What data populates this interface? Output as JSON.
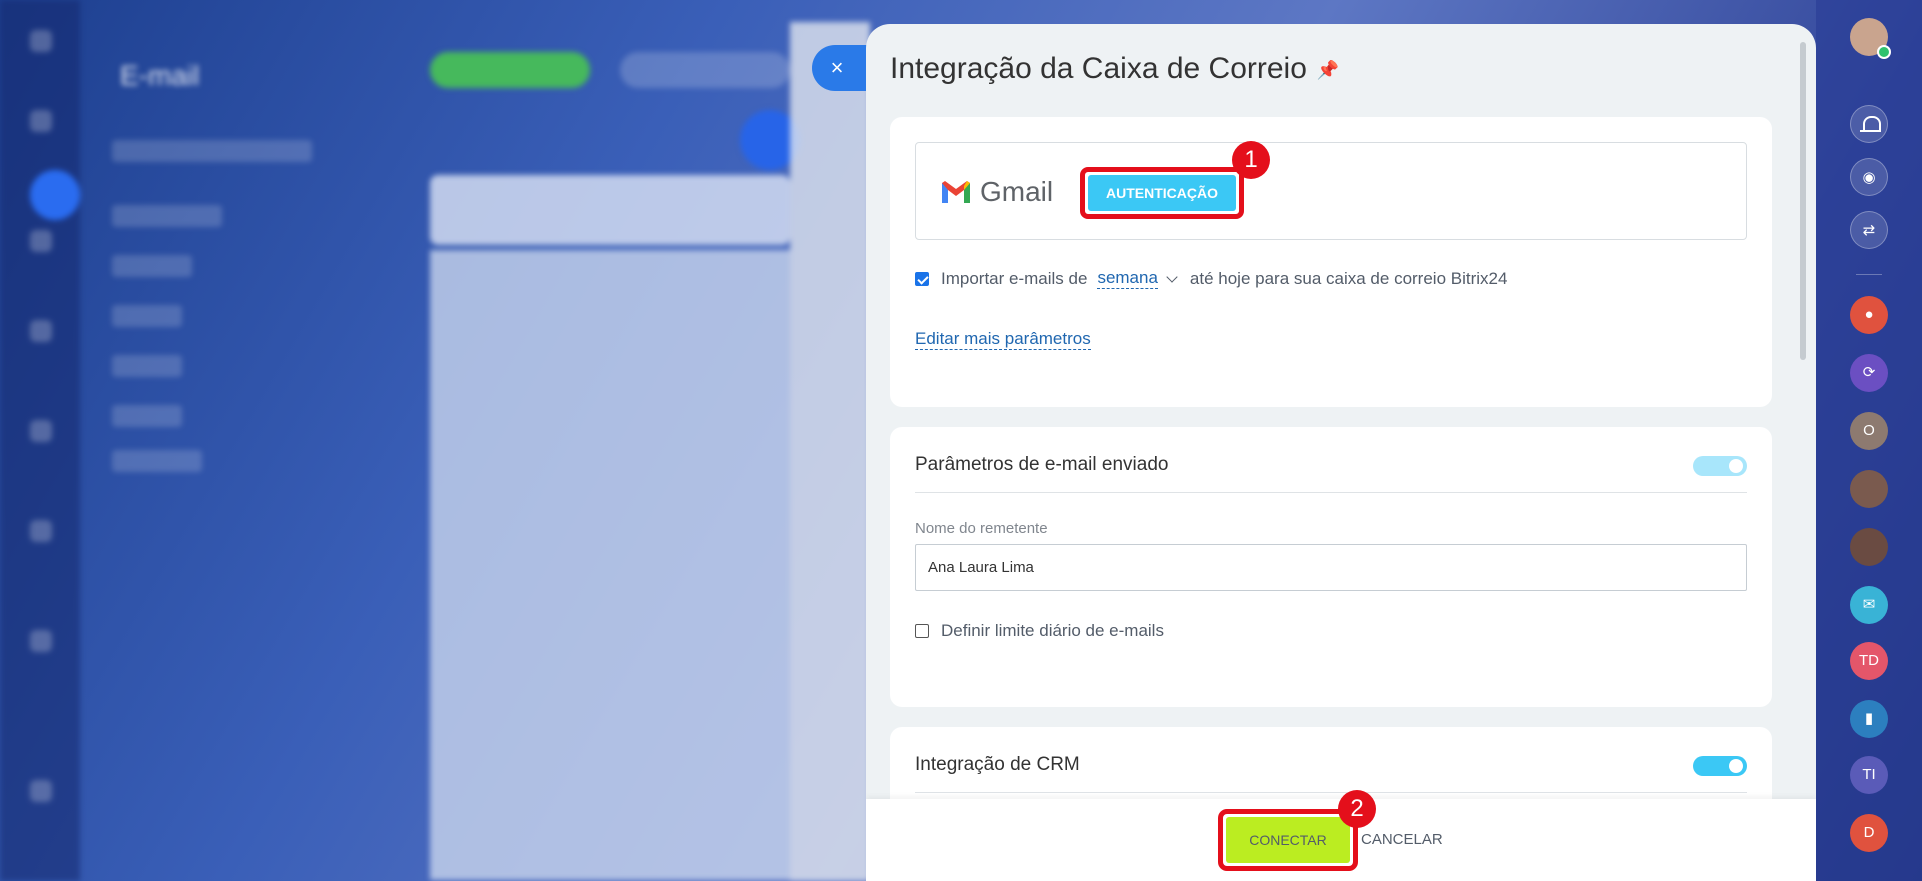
{
  "background": {
    "app_title": "E-mail"
  },
  "panel": {
    "title": "Integração da Caixa de Correio",
    "close_symbol": "×"
  },
  "auth_card": {
    "provider_name": "Gmail",
    "auth_button_label": "AUTENTICAÇÃO",
    "import_prefix": "Importar e-mails de",
    "import_period": "semana",
    "import_suffix": "até hoje para sua caixa de correio Bitrix24",
    "import_checked": true,
    "edit_more_link": "Editar mais parâmetros"
  },
  "sent_params": {
    "title": "Parâmetros de e-mail enviado",
    "toggle_on": true,
    "sender_label": "Nome do remetente",
    "sender_value": "Ana Laura Lima",
    "daily_limit_label": "Definir limite diário de e-mails",
    "daily_limit_checked": false
  },
  "crm": {
    "title": "Integração de CRM",
    "toggle_on": true
  },
  "footer": {
    "connect_label": "CONECTAR",
    "cancel_label": "CANCELAR"
  },
  "annotations": {
    "step1": "1",
    "step2": "2",
    "highlight_color": "#e40f1b"
  },
  "right_rail": {
    "items": [
      {
        "type": "avatar",
        "name": "user-avatar"
      },
      {
        "type": "icon",
        "name": "bell-icon"
      },
      {
        "type": "icon",
        "name": "fingerprint-icon"
      },
      {
        "type": "icon",
        "name": "sync-icon"
      },
      {
        "type": "chat",
        "initials": "",
        "color": "#e0523e"
      },
      {
        "type": "chat",
        "initials": "",
        "color": "#6b4fc2"
      },
      {
        "type": "chat",
        "initials": "O",
        "color": "#8d7a70"
      },
      {
        "type": "chat",
        "initials": "",
        "color": "#7a5a4e"
      },
      {
        "type": "chat",
        "initials": "",
        "color": "#6a4b42"
      },
      {
        "type": "chat",
        "initials": "",
        "color": "#39b3d6"
      },
      {
        "type": "chat",
        "initials": "TD",
        "color": "#e4566a"
      },
      {
        "type": "chat",
        "initials": "",
        "color": "#2c7fbf"
      },
      {
        "type": "chat",
        "initials": "TI",
        "color": "#5a5bb8"
      },
      {
        "type": "chat",
        "initials": "D",
        "color": "#e0523e"
      }
    ]
  },
  "colors": {
    "accent": "#3bc8f5",
    "connect": "#bbed21",
    "link": "#2067b0"
  }
}
